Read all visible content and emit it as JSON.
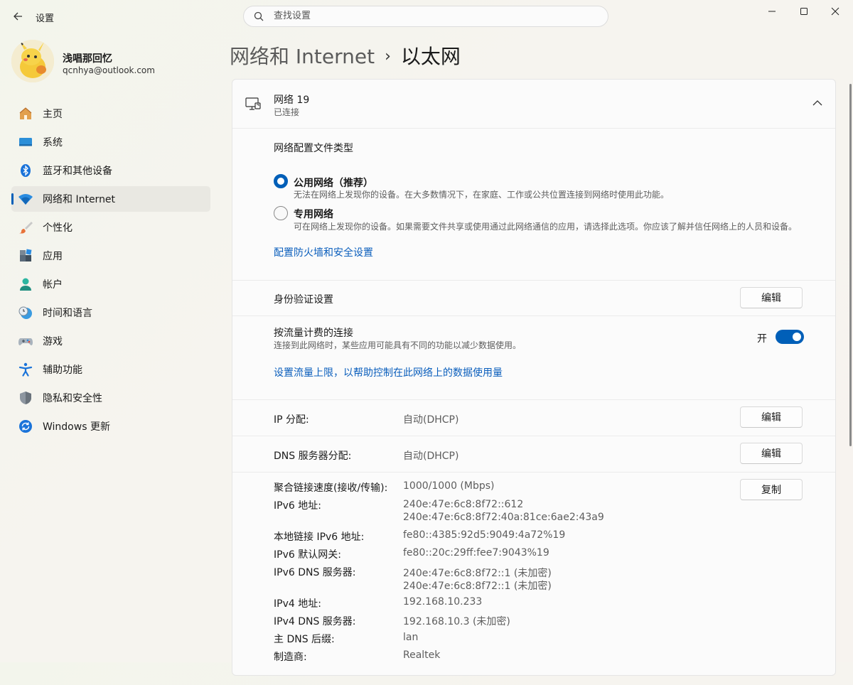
{
  "app": {
    "title": "设置",
    "search_placeholder": "查找设置"
  },
  "user": {
    "name": "浅唱那回忆",
    "email": "qcnhya@outlook.com"
  },
  "sidebar": {
    "items": [
      {
        "label": "主页",
        "icon": "home-icon"
      },
      {
        "label": "系统",
        "icon": "system-icon"
      },
      {
        "label": "蓝牙和其他设备",
        "icon": "bluetooth-icon"
      },
      {
        "label": "网络和 Internet",
        "icon": "wifi-icon",
        "active": true
      },
      {
        "label": "个性化",
        "icon": "brush-icon"
      },
      {
        "label": "应用",
        "icon": "apps-icon"
      },
      {
        "label": "帐户",
        "icon": "account-icon"
      },
      {
        "label": "时间和语言",
        "icon": "time-language-icon"
      },
      {
        "label": "游戏",
        "icon": "gamepad-icon"
      },
      {
        "label": "辅助功能",
        "icon": "accessibility-icon"
      },
      {
        "label": "隐私和安全性",
        "icon": "shield-icon"
      },
      {
        "label": "Windows 更新",
        "icon": "update-icon"
      }
    ]
  },
  "breadcrumb": {
    "parent": "网络和 Internet",
    "separator": "›",
    "current": "以太网"
  },
  "network": {
    "name": "网络 19",
    "status": "已连接"
  },
  "profile": {
    "heading": "网络配置文件类型",
    "public_title": "公用网络（推荐）",
    "public_desc": "无法在网络上发现你的设备。在大多数情况下，在家庭、工作或公共位置连接到网络时使用此功能。",
    "private_title": "专用网络",
    "private_desc": "可在网络上发现你的设备。如果需要文件共享或使用通过此网络通信的应用，请选择此选项。你应该了解并信任网络上的人员和设备。",
    "selected": "public",
    "firewall_link": "配置防火墙和安全设置"
  },
  "auth": {
    "label": "身份验证设置",
    "button": "编辑"
  },
  "metered": {
    "label": "按流量计费的连接",
    "desc": "连接到此网络时，某些应用可能具有不同的功能以减少数据使用。",
    "state_label": "开",
    "on": true,
    "link": "设置流量上限，以帮助控制在此网络上的数据使用量"
  },
  "ip": {
    "label": "IP 分配:",
    "value": "自动(DHCP)",
    "button": "编辑"
  },
  "dns": {
    "label": "DNS 服务器分配:",
    "value": "自动(DHCP)",
    "button": "编辑"
  },
  "properties": {
    "copy_button": "复制",
    "rows": [
      {
        "label": "聚合链接速度(接收/传输):",
        "values": [
          "1000/1000 (Mbps)"
        ]
      },
      {
        "label": "IPv6 地址:",
        "values": [
          "240e:47e:6c8:8f72::612",
          "240e:47e:6c8:8f72:40a:81ce:6ae2:43a9"
        ]
      },
      {
        "label": "本地链接 IPv6 地址:",
        "values": [
          "fe80::4385:92d5:9049:4a72%19"
        ]
      },
      {
        "label": "IPv6 默认网关:",
        "values": [
          "fe80::20c:29ff:fee7:9043%19"
        ]
      },
      {
        "label": "IPv6 DNS 服务器:",
        "values": [
          "240e:47e:6c8:8f72::1 (未加密)",
          "240e:47e:6c8:8f72::1 (未加密)"
        ]
      },
      {
        "label": "IPv4 地址:",
        "values": [
          "192.168.10.233"
        ]
      },
      {
        "label": "IPv4 DNS 服务器:",
        "values": [
          "192.168.10.3 (未加密)"
        ]
      },
      {
        "label": "主 DNS 后缀:",
        "values": [
          "lan"
        ]
      },
      {
        "label": "制造商:",
        "values": [
          "Realtek"
        ]
      }
    ]
  },
  "colors": {
    "accent": "#005fb8",
    "link": "#0a5ebc"
  }
}
